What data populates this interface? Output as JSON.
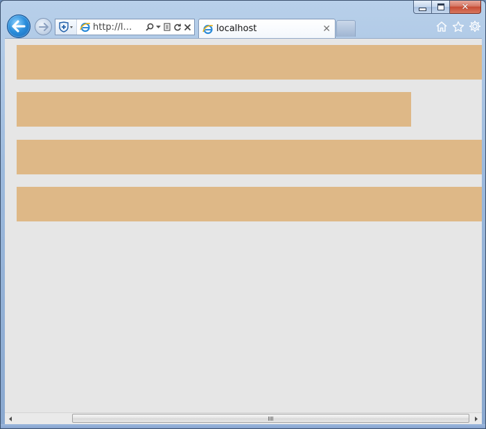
{
  "window": {
    "caption_close_symbol": "✕"
  },
  "address_bar": {
    "url": "http://l…"
  },
  "tab": {
    "title": "localhost",
    "close_symbol": "✕"
  },
  "page": {
    "background_color": "#e6e6e6",
    "bar_color": "#deb887"
  },
  "icons": {
    "back": "back-arrow-icon",
    "forward": "forward-arrow-icon",
    "compatibility": "shield-plus-icon",
    "site": "ie-logo-icon",
    "search": "search-icon",
    "dropdown": "chevron-down-icon",
    "compat_view": "compatibility-view-icon",
    "refresh": "refresh-icon",
    "stop": "stop-icon",
    "home": "home-icon",
    "favorites": "star-icon",
    "tools": "gear-icon"
  }
}
